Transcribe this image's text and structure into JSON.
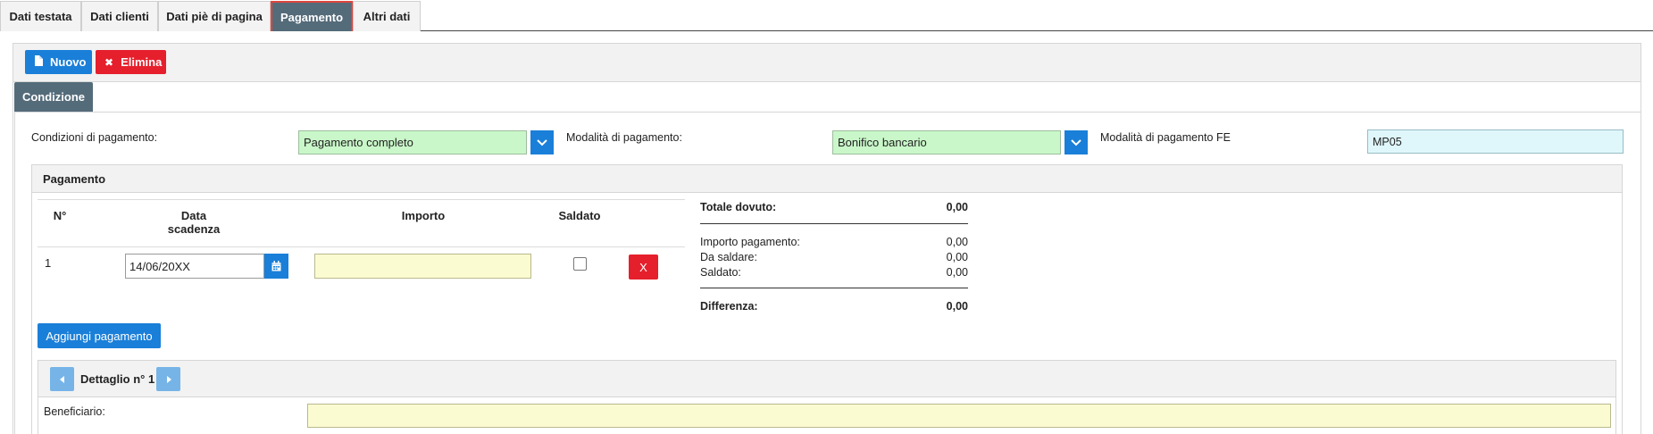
{
  "tabs": [
    {
      "label": "Dati testata"
    },
    {
      "label": "Dati clienti"
    },
    {
      "label": "Dati piè di pagina"
    },
    {
      "label": "Pagamento"
    },
    {
      "label": "Altri dati"
    }
  ],
  "toolbar": {
    "new_label": "Nuovo",
    "delete_label": "Elimina"
  },
  "subtab": {
    "label": "Condizione"
  },
  "condizione": {
    "condizioni_label": "Condizioni di pagamento:",
    "condizioni_value": "Pagamento completo",
    "modalita_label": "Modalità di pagamento:",
    "modalita_value": "Bonifico bancario",
    "modalita_fe_label": "Modalità di pagamento FE",
    "modalita_fe_value": "MP05"
  },
  "pagamento": {
    "title": "Pagamento",
    "columns": {
      "n": "N°",
      "data_line1": "Data",
      "data_line2": "scadenza",
      "importo": "Importo",
      "saldato": "Saldato"
    },
    "rows": [
      {
        "n": "1",
        "data": "14/06/20XX",
        "importo": "",
        "saldato": false,
        "delete_label": "X"
      }
    ],
    "add_label": "Aggiungi pagamento"
  },
  "summary": {
    "totale_label": "Totale dovuto:",
    "totale_value": "0,00",
    "importo_label": "Importo pagamento:",
    "importo_value": "0,00",
    "da_saldare_label": "Da saldare:",
    "da_saldare_value": "0,00",
    "saldato_label": "Saldato:",
    "saldato_value": "0,00",
    "differenza_label": "Differenza:",
    "differenza_value": "0,00"
  },
  "dettaglio": {
    "title": "Dettaglio n° 1",
    "beneficiario_label": "Beneficiario:",
    "beneficiario_value": ""
  },
  "colors": {
    "primary": "#1a7fd8",
    "danger": "#e61f2c",
    "tab_active": "#546b7a",
    "select_bg": "#c9f7c9",
    "input_yellow": "#fbfbd2"
  }
}
